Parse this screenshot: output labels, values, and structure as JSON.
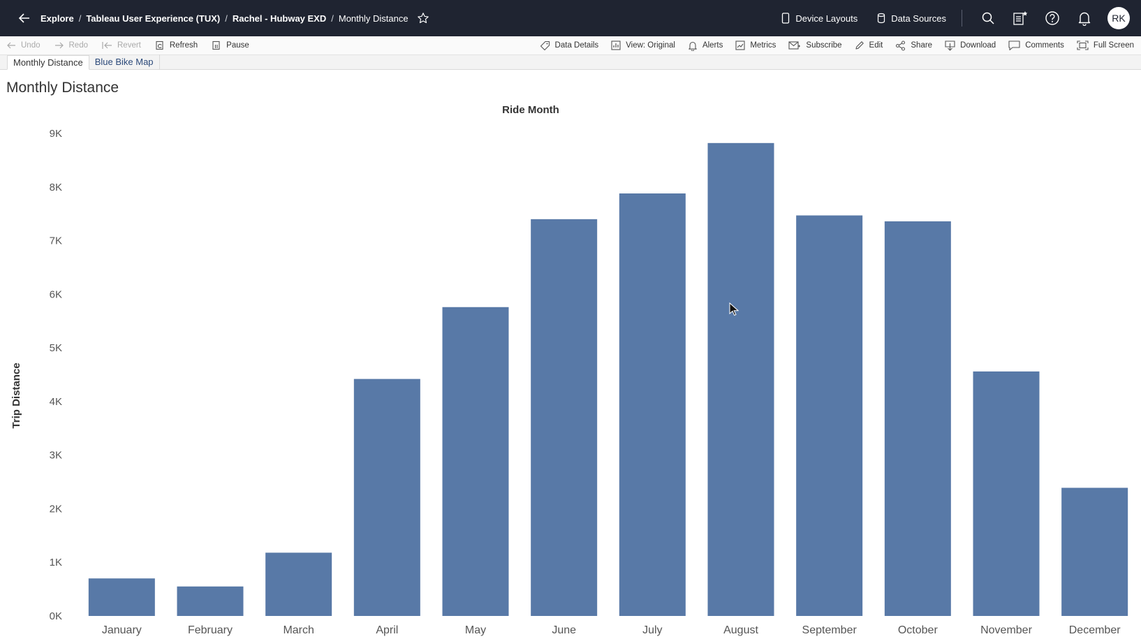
{
  "breadcrumb": {
    "items": [
      "Explore",
      "Tableau User Experience (TUX)",
      "Rachel - Hubway EXD",
      "Monthly Distance"
    ],
    "separator": "/"
  },
  "topbar": {
    "device_layouts": "Device Layouts",
    "data_sources": "Data Sources",
    "avatar_initials": "RK"
  },
  "toolbar": {
    "undo": "Undo",
    "redo": "Redo",
    "revert": "Revert",
    "refresh": "Refresh",
    "pause": "Pause",
    "data_details": "Data Details",
    "view": "View: Original",
    "alerts": "Alerts",
    "metrics": "Metrics",
    "subscribe": "Subscribe",
    "edit": "Edit",
    "share": "Share",
    "download": "Download",
    "comments": "Comments",
    "full_screen": "Full Screen"
  },
  "tabs": [
    {
      "label": "Monthly Distance",
      "active": true
    },
    {
      "label": "Blue Bike Map",
      "active": false
    }
  ],
  "sheet": {
    "title": "Monthly Distance"
  },
  "colors": {
    "bar": "#5879a7",
    "topbar": "#1f2431"
  },
  "chart_data": {
    "type": "bar",
    "title": "Ride Month",
    "xlabel": "Ride Month",
    "ylabel": "Trip Distance",
    "categories": [
      "January",
      "February",
      "March",
      "April",
      "May",
      "June",
      "July",
      "August",
      "September",
      "October",
      "November",
      "December"
    ],
    "values": [
      700,
      550,
      1180,
      4420,
      5760,
      7400,
      7880,
      8820,
      7470,
      7360,
      4560,
      2390
    ],
    "ylim": [
      0,
      9000
    ],
    "yticks": [
      0,
      1000,
      2000,
      3000,
      4000,
      5000,
      6000,
      7000,
      8000,
      9000
    ],
    "ytick_labels": [
      "0K",
      "1K",
      "2K",
      "3K",
      "4K",
      "5K",
      "6K",
      "7K",
      "8K",
      "9K"
    ],
    "grid": false,
    "legend": "none"
  }
}
